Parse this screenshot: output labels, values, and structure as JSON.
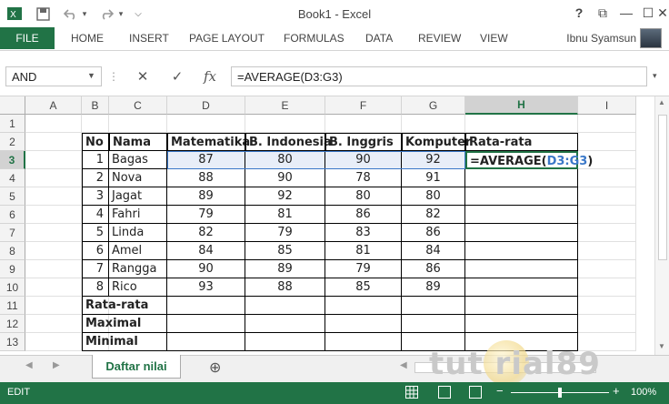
{
  "window": {
    "title": "Book1 - Excel",
    "user": "Ibnu Syamsun",
    "accent": "#217346"
  },
  "quick_access": {
    "icons": [
      "excel-logo-icon",
      "save-icon",
      "undo-icon",
      "redo-icon",
      "customize-icon"
    ],
    "undo_arrow": "▾",
    "redo_arrow": "▾",
    "customize": "⌵"
  },
  "window_controls": {
    "help": "?",
    "restore": "⧉",
    "minimize": "—",
    "maximize": "☐",
    "close": "✕"
  },
  "ribbon": {
    "file": "FILE",
    "tabs": [
      "HOME",
      "INSERT",
      "PAGE LAYOUT",
      "FORMULAS",
      "DATA",
      "REVIEW",
      "VIEW"
    ]
  },
  "formula_bar": {
    "name_box": "AND",
    "cancel": "✕",
    "enter": "✓",
    "fx": "fx",
    "formula": "=AVERAGE(D3:G3)"
  },
  "columns": [
    "A",
    "B",
    "C",
    "D",
    "E",
    "F",
    "G",
    "H",
    "I"
  ],
  "selected_column": "H",
  "rows": [
    "1",
    "2",
    "3",
    "4",
    "5",
    "6",
    "7",
    "8",
    "9",
    "10",
    "11",
    "12",
    "13"
  ],
  "selected_row": "3",
  "table": {
    "headers": [
      "No",
      "Nama",
      "Matematika",
      "B. Indonesia",
      "B. Inggris",
      "Komputer",
      "Rata-rata"
    ],
    "records": [
      [
        "1",
        "Bagas",
        "87",
        "80",
        "90",
        "92"
      ],
      [
        "2",
        "Nova",
        "88",
        "90",
        "78",
        "91"
      ],
      [
        "3",
        "Jagat",
        "89",
        "92",
        "80",
        "80"
      ],
      [
        "4",
        "Fahri",
        "79",
        "81",
        "86",
        "82"
      ],
      [
        "5",
        "Linda",
        "82",
        "79",
        "83",
        "86"
      ],
      [
        "6",
        "Amel",
        "84",
        "85",
        "81",
        "84"
      ],
      [
        "7",
        "Rangga",
        "90",
        "89",
        "79",
        "86"
      ],
      [
        "8",
        "Rico",
        "93",
        "88",
        "85",
        "89"
      ]
    ],
    "summary_labels": [
      "Rata-rata",
      "Maximal",
      "Minimal"
    ],
    "editing_cell": {
      "prefix": "=AVERAGE(",
      "reference": "D3:G3",
      "suffix": ")"
    }
  },
  "sheets": {
    "active": "Daftar nilai",
    "add": "⊕"
  },
  "status": {
    "mode": "EDIT",
    "zoom": "100%"
  },
  "watermark": "tut rial89"
}
